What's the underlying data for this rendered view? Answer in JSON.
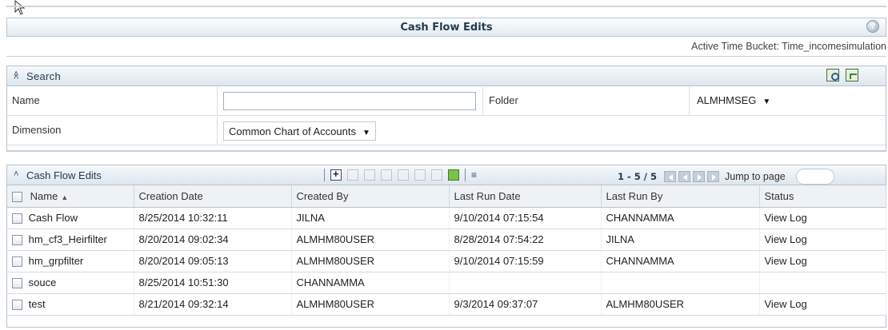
{
  "header": {
    "title": "Cash Flow Edits",
    "time_bucket": "Active Time Bucket: Time_incomesimulation"
  },
  "search": {
    "title": "Search",
    "name_label": "Name",
    "name_value": "",
    "folder_label": "Folder",
    "folder_value": "ALMHMSEG",
    "dimension_label": "Dimension",
    "dimension_value": "Common Chart of Accounts"
  },
  "grid": {
    "title": "Cash Flow Edits",
    "pager_count": "1 - 5 / 5",
    "jump_label": "Jump to page",
    "columns": [
      "Name",
      "Creation Date",
      "Created By",
      "Last Run Date",
      "Last Run By",
      "Status"
    ],
    "sorted_column": "Name",
    "sort_direction": "ascending",
    "rows": [
      {
        "name": "Cash Flow",
        "creation_date": "8/25/2014 10:32:11",
        "created_by": "JILNA",
        "last_run_date": "9/10/2014 07:15:54",
        "last_run_by": "CHANNAMMA",
        "status": "View Log"
      },
      {
        "name": "hm_cf3_Heirfilter",
        "creation_date": "8/20/2014 09:02:34",
        "created_by": "ALMHM80USER",
        "last_run_date": "8/28/2014 07:54:22",
        "last_run_by": "JILNA",
        "status": "View Log"
      },
      {
        "name": "hm_grpfilter",
        "creation_date": "8/20/2014 09:05:13",
        "created_by": "ALMHM80USER",
        "last_run_date": "9/10/2014 07:15:59",
        "last_run_by": "CHANNAMMA",
        "status": "View Log"
      },
      {
        "name": "souce",
        "creation_date": "8/25/2014 10:51:30",
        "created_by": "CHANNAMMA",
        "last_run_date": "",
        "last_run_by": "",
        "status": ""
      },
      {
        "name": "test",
        "creation_date": "8/21/2014 09:32:14",
        "created_by": "ALMHM80USER",
        "last_run_date": "9/3/2014 09:37:07",
        "last_run_by": "ALMHM80USER",
        "status": "View Log"
      }
    ]
  }
}
